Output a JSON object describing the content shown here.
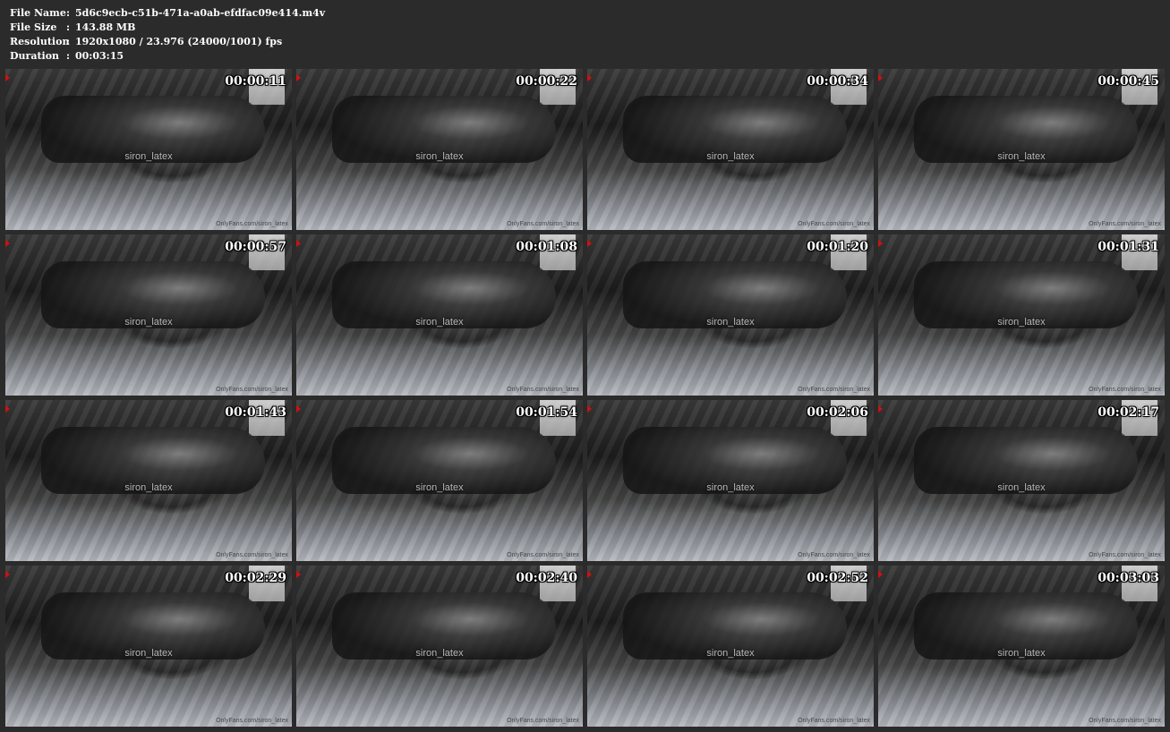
{
  "header": {
    "rows": [
      {
        "key": "File Name",
        "sep": ":",
        "value": "5d6c9ecb-c51b-471a-a0ab-efdfac09e414.m4v"
      },
      {
        "key": "File Size",
        "sep": ":",
        "value": "143.88 MB"
      },
      {
        "key": "Resolution",
        "sep": ":",
        "value": "1920x1080 / 23.976 (24000/1001) fps"
      },
      {
        "key": "Duration",
        "sep": ":",
        "value": "00:03:15"
      }
    ]
  },
  "thumbnails": [
    {
      "timestamp": "00:00:11",
      "watermark": "siron_latex",
      "credit": "OnlyFans.com/siron_latex"
    },
    {
      "timestamp": "00:00:22",
      "watermark": "siron_latex",
      "credit": "OnlyFans.com/siron_latex"
    },
    {
      "timestamp": "00:00:34",
      "watermark": "siron_latex",
      "credit": "OnlyFans.com/siron_latex"
    },
    {
      "timestamp": "00:00:45",
      "watermark": "siron_latex",
      "credit": "OnlyFans.com/siron_latex"
    },
    {
      "timestamp": "00:00:57",
      "watermark": "siron_latex",
      "credit": "OnlyFans.com/siron_latex"
    },
    {
      "timestamp": "00:01:08",
      "watermark": "siron_latex",
      "credit": "OnlyFans.com/siron_latex"
    },
    {
      "timestamp": "00:01:20",
      "watermark": "siron_latex",
      "credit": "OnlyFans.com/siron_latex"
    },
    {
      "timestamp": "00:01:31",
      "watermark": "siron_latex",
      "credit": "OnlyFans.com/siron_latex"
    },
    {
      "timestamp": "00:01:43",
      "watermark": "siron_latex",
      "credit": "OnlyFans.com/siron_latex"
    },
    {
      "timestamp": "00:01:54",
      "watermark": "siron_latex",
      "credit": "OnlyFans.com/siron_latex"
    },
    {
      "timestamp": "00:02:06",
      "watermark": "siron_latex",
      "credit": "OnlyFans.com/siron_latex"
    },
    {
      "timestamp": "00:02:17",
      "watermark": "siron_latex",
      "credit": "OnlyFans.com/siron_latex"
    },
    {
      "timestamp": "00:02:29",
      "watermark": "siron_latex",
      "credit": "OnlyFans.com/siron_latex"
    },
    {
      "timestamp": "00:02:40",
      "watermark": "siron_latex",
      "credit": "OnlyFans.com/siron_latex"
    },
    {
      "timestamp": "00:02:52",
      "watermark": "siron_latex",
      "credit": "OnlyFans.com/siron_latex"
    },
    {
      "timestamp": "00:03:03",
      "watermark": "siron_latex",
      "credit": "OnlyFans.com/siron_latex"
    }
  ],
  "colors": {
    "background": "#2b2b2b",
    "text": "#ffffff",
    "marker": "#d01010"
  }
}
